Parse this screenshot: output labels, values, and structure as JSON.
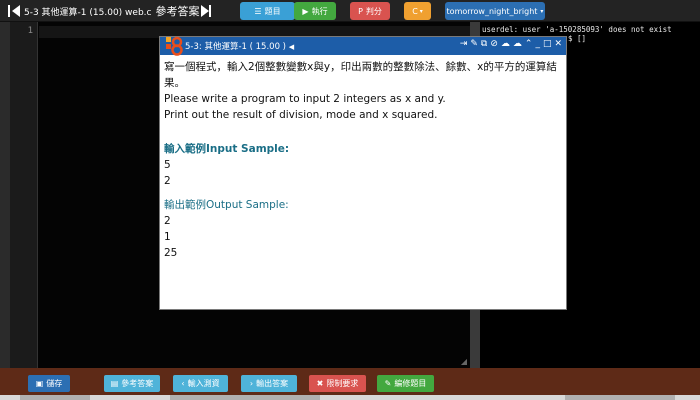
{
  "header": {
    "title": "5-3 其他運算-1 (15.00) web.c",
    "answer_label": "參考答案"
  },
  "toolbar": {
    "problem_label": "題目",
    "run_label": "執行",
    "judge_label": "判分",
    "language_label": "C",
    "theme_label": "tomorrow_night_bright"
  },
  "editor": {
    "line_numbers": [
      "1"
    ]
  },
  "terminal": {
    "lines": [
      "userdel: user 'a-150285093' does not exist",
      "$ []"
    ]
  },
  "problem_window": {
    "title": "5-3: 其他運算-1 ( 15.00 )",
    "description_zh": "寫一個程式，輸入2個整數變數x與y，印出兩數的整數除法、餘數、x的平方的運算結果。",
    "description_en_1": "Please write a program to input 2 integers as x and y.",
    "description_en_2": "Print out the result of division, mode and x squared.",
    "input_heading": "輸入範例Input Sample:",
    "input_lines": [
      "5",
      "2"
    ],
    "output_heading": "輸出範例Output Sample:",
    "output_lines": [
      "2",
      "1",
      "25"
    ]
  },
  "bottom": {
    "save_label": "儲存",
    "answer_label": "參考答案",
    "input_test_label": "輸入測資",
    "output_answer_label": "輸出答案",
    "limits_label": "限制要求",
    "edit_label": "編修題目"
  },
  "colors": {
    "topbar": "#232323",
    "editor_bg": "#040404",
    "window_title": "#1d5da8",
    "bottombar": "#5e2a17",
    "btn_problem": "#3aa0d6",
    "btn_run": "#43a83f",
    "btn_judge": "#d9534f",
    "btn_lang": "#f0a030",
    "btn_theme": "#2c6fb3"
  }
}
